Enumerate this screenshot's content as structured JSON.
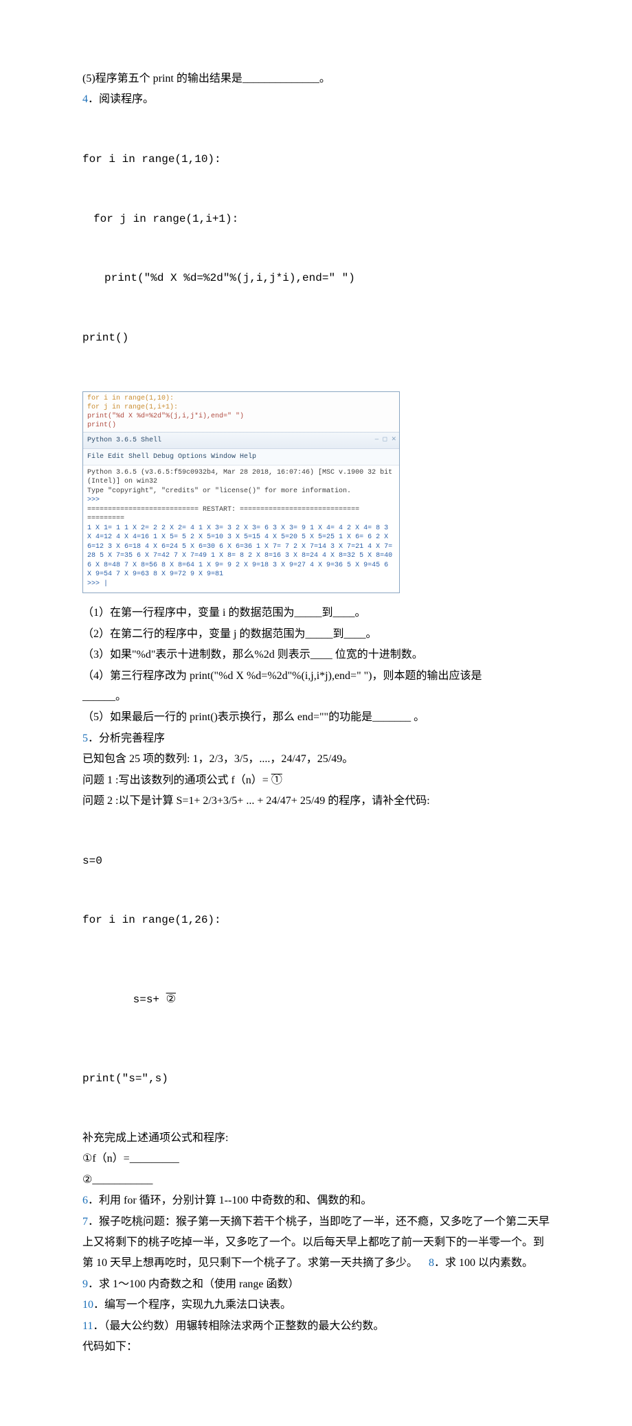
{
  "q5_intro": "(5)程序第五个 print 的输出结果是______________。",
  "q4": {
    "num": "4",
    "title": "．阅读程序。",
    "code1": "for i in range(1,10):",
    "code2": "for j in range(1,i+1):",
    "code3": "print(\"%d X %d=%2d\"%(j,i,j*i),end=\" \")",
    "code4": "print()",
    "shell_top1": "for i in range(1,10):",
    "shell_top2": "    for j in range(1,i+1):",
    "shell_top3": "        print(\"%d X %d=%2d\"%(j,i,j*i),end=\" \")",
    "shell_top4": "print()",
    "shell_title": "Python 3.6.5 Shell",
    "shell_menu": "File   Edit   Shell   Debug   Options   Window   Help",
    "shell_intro1": "Python 3.6.5 (v3.6.5:f59c0932b4, Mar 28 2018, 16:07:46) [MSC v.1900 32 bit (Intel)] on win32",
    "shell_intro2": "Type \"copyright\", \"credits\" or \"license()\" for more information.",
    "shell_prompt": ">>>",
    "shell_restart": "=========================== RESTART: ============================= ",
    "shell_eqline": "=========",
    "shell_output": "1 X 1= 1 1 X 2= 2 2 X 2= 4 1 X 3= 3 2 X 3= 6 3 X 3= 9 1 X 4= 4 2 X 4= 8 3 X 4=12 4 X 4=16 1 X 5= 5 2 X 5=10 3 X 5=15 4 X 5=20 5 X 5=25 1 X 6= 6 2 X 6=12 3 X 6=18 4 X 6=24 5 X 6=30 6 X 6=36 1 X 7= 7 2 X 7=14 3 X 7=21 4 X 7=28 5 X 7=35 6 X 7=42 7 X 7=49 1 X 8= 8 2 X 8=16 3 X 8=24 4 X 8=32 5 X 8=40 6 X 8=48 7 X 8=56 8 X 8=64 1 X 9= 9 2 X 9=18 3 X 9=27 4 X 9=36 5 X 9=45 6 X 9=54 7 X 9=63 8 X 9=72 9 X 9=81",
    "shell_end": ">>> |",
    "sub1": "（1）在第一行程序中，变量 i 的数据范围为_____到____。",
    "sub2": "（2）在第二行的程序中，变量 j 的数据范围为_____到____。",
    "sub3": "（3）如果\"%d\"表示十进制数，那么%2d 则表示____ 位宽的十进制数。",
    "sub4a": "（4）第三行程序改为 print(\"%d X %d=%2d\"%(i,j,i*j),end=\" \")，则本题的输出应该是",
    "sub4b": "______。",
    "sub5": "（5）如果最后一行的 print()表示换行，那么 end=\"\"的功能是_______ 。"
  },
  "q5": {
    "num": "5",
    "title": "．分析完善程序",
    "l1": "已知包含 25 项的数列: 1，2/3，3/5，....，24/47，25/49。",
    "l2a": "问题 1 :写出该数列的通项公式 f（n）= ",
    "l2b": "①",
    "l3": "问题 2 :以下是计算 S=1+ 2/3+3/5+ ... + 24/47+ 25/49 的程序，请补全代码:",
    "c1": "s=0",
    "c2": "for i in range(1,26):",
    "c3a": "s=s+ ",
    "c3b": "②",
    "c4": "print(\"s=\",s)",
    "l4": "补充完成上述通项公式和程序:",
    "l5": "①f（n）=_________",
    "l6": "②___________"
  },
  "q6": {
    "num": "6",
    "text": "．利用 for 循环，分别计算 1--100 中奇数的和、偶数的和。"
  },
  "q7": {
    "num": "7",
    "text": "．猴子吃桃问题：猴子第一天摘下若干个桃子，当即吃了一半，还不瘾，又多吃了一个第二天早上又将剩下的桃子吃掉一半，又多吃了一个。以后每天早上都吃了前一天剩下的一半零一个。到第 10 天早上想再吃时，见只剩下一个桃子了。求第一天共摘了多少。"
  },
  "q8": {
    "num": "8",
    "text": "．求 100 以内素数。"
  },
  "q9": {
    "num": "9",
    "text": "．求 1～100 内奇数之和（使用 range 函数）"
  },
  "q10": {
    "num": "10",
    "text": "．编写一个程序，实现九九乘法口诀表。"
  },
  "q11": {
    "num": "11",
    "text": "．（最大公约数）用辗转相除法求两个正整数的最大公约数。",
    "tail": "代码如下："
  }
}
